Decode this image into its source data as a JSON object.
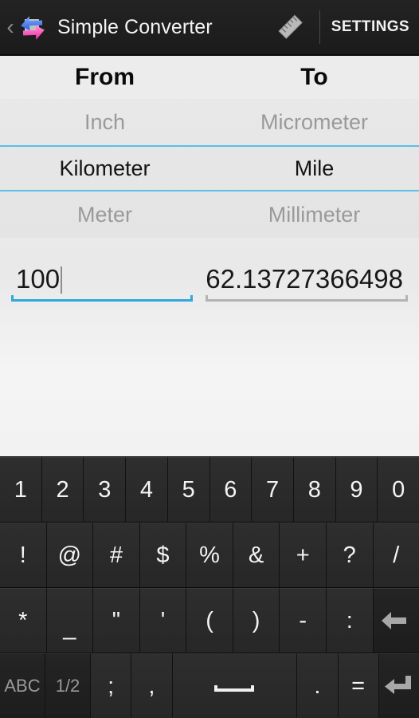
{
  "actionbar": {
    "back_icon": "chevron-left-icon",
    "app_icon": "convert-arrows-icon",
    "title": "Simple Converter",
    "ruler_icon": "ruler-icon",
    "settings_label": "SETTINGS"
  },
  "converter": {
    "headers": {
      "from": "From",
      "to": "To"
    },
    "rows": [
      {
        "from": "Inch",
        "to": "Micrometer",
        "selected": false
      },
      {
        "from": "Kilometer",
        "to": "Mile",
        "selected": true
      },
      {
        "from": "Meter",
        "to": "Millimeter",
        "selected": false
      }
    ],
    "input": {
      "value": "100",
      "focused": true
    },
    "output": {
      "value": "62.13727366498",
      "focused": false
    }
  },
  "colors": {
    "accent_blue": "#33b5e5",
    "selection_line": "#5bbfe8",
    "actionbar_bg": "#1e1e1e",
    "content_bg": "#ececec",
    "key_bg": "#2e2e2e",
    "key_text": "#f4f4f4",
    "key_fn_text": "#9a9a9a"
  },
  "keyboard": {
    "rows": [
      {
        "keys": [
          {
            "label": "1",
            "name": "key-1"
          },
          {
            "label": "2",
            "name": "key-2"
          },
          {
            "label": "3",
            "name": "key-3"
          },
          {
            "label": "4",
            "name": "key-4"
          },
          {
            "label": "5",
            "name": "key-5"
          },
          {
            "label": "6",
            "name": "key-6"
          },
          {
            "label": "7",
            "name": "key-7"
          },
          {
            "label": "8",
            "name": "key-8"
          },
          {
            "label": "9",
            "name": "key-9"
          },
          {
            "label": "0",
            "name": "key-0"
          }
        ]
      },
      {
        "keys": [
          {
            "label": "!",
            "name": "key-exclamation"
          },
          {
            "label": "@",
            "name": "key-at"
          },
          {
            "label": "#",
            "name": "key-hash"
          },
          {
            "label": "$",
            "name": "key-dollar"
          },
          {
            "label": "%",
            "name": "key-percent"
          },
          {
            "label": "&",
            "name": "key-ampersand"
          },
          {
            "label": "+",
            "name": "key-plus"
          },
          {
            "label": "?",
            "name": "key-question"
          },
          {
            "label": "/",
            "name": "key-slash"
          }
        ]
      },
      {
        "keys": [
          {
            "label": "*",
            "name": "key-asterisk"
          },
          {
            "label": "_",
            "name": "key-underscore"
          },
          {
            "label": "\"",
            "name": "key-doublequote"
          },
          {
            "label": "'",
            "name": "key-apostrophe"
          },
          {
            "label": "(",
            "name": "key-paren-open"
          },
          {
            "label": ")",
            "name": "key-paren-close"
          },
          {
            "label": "-",
            "name": "key-hyphen"
          },
          {
            "label": ":",
            "name": "key-colon"
          },
          {
            "label": "",
            "name": "key-backspace",
            "icon": "backspace-arrow-icon"
          }
        ]
      },
      {
        "keys": [
          {
            "label": "ABC",
            "name": "key-abc"
          },
          {
            "label": "1/2",
            "name": "key-page-toggle"
          },
          {
            "label": ";",
            "name": "key-semicolon"
          },
          {
            "label": ",",
            "name": "key-comma"
          },
          {
            "label": "",
            "name": "key-space",
            "icon": "spacebar-icon"
          },
          {
            "label": ".",
            "name": "key-period"
          },
          {
            "label": "=",
            "name": "key-equals"
          },
          {
            "label": "",
            "name": "key-enter",
            "icon": "enter-arrow-icon"
          }
        ]
      }
    ]
  }
}
